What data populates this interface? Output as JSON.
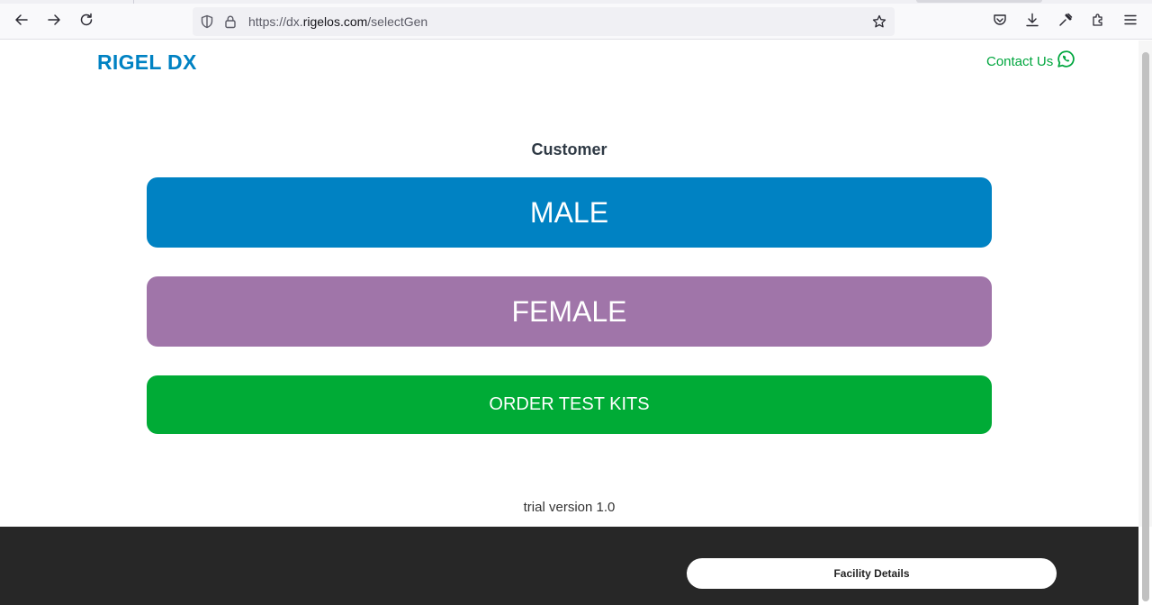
{
  "browser": {
    "url_prefix": "https://dx.",
    "url_host": "rigelos.com",
    "url_path": "/selectGen",
    "icons": [
      "back-arrow-icon",
      "forward-arrow-icon",
      "reload-icon",
      "shield-icon",
      "lock-icon",
      "bookmark-star-icon",
      "pocket-icon",
      "download-icon",
      "eyedropper-icon",
      "extensions-icon",
      "menu-icon"
    ]
  },
  "header": {
    "logo": "RIGEL DX",
    "contact_label": "Contact Us",
    "contact_icon": "whatsapp-icon"
  },
  "main": {
    "heading": "Customer",
    "male_label": "MALE",
    "female_label": "FEMALE",
    "order_label": "ORDER TEST KITS",
    "version": "trial version 1.0"
  },
  "footer": {
    "facility_label": "Facility Details"
  },
  "colors": {
    "brand_blue": "#0082c3",
    "female_purple": "#a075a9",
    "order_green": "#00ab36",
    "contact_green": "#00a63e",
    "footer_bg": "#272727"
  }
}
